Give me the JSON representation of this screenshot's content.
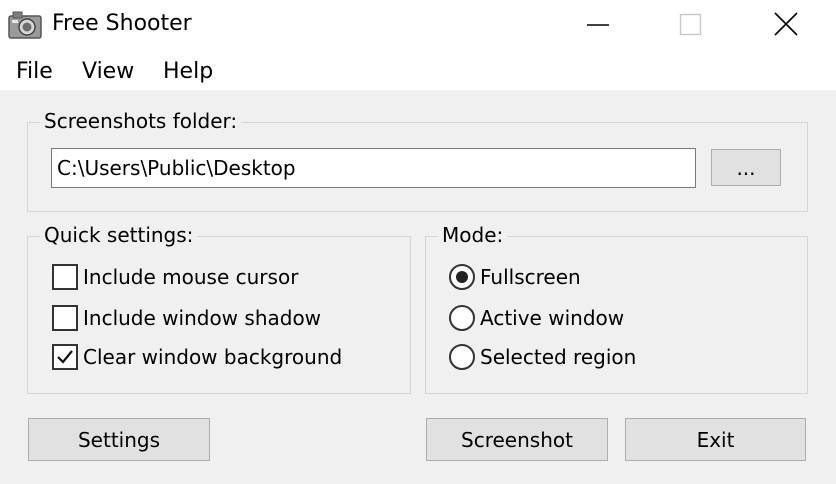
{
  "window": {
    "title": "Free Shooter",
    "app_icon": "camera-icon",
    "controls": [
      "minimize-icon",
      "maximize-icon",
      "close-icon"
    ]
  },
  "menu": [
    "File",
    "View",
    "Help"
  ],
  "folder": {
    "legend": "Screenshots folder:",
    "path": "C:\\Users\\Public\\Desktop",
    "browse_label": "..."
  },
  "quick_settings": {
    "legend": "Quick settings:",
    "options": [
      {
        "label": "Include mouse cursor",
        "checked": false
      },
      {
        "label": "Include window shadow",
        "checked": false
      },
      {
        "label": "Clear window background",
        "checked": true
      }
    ]
  },
  "mode": {
    "legend": "Mode:",
    "options": [
      {
        "label": "Fullscreen",
        "selected": true
      },
      {
        "label": "Active window",
        "selected": false
      },
      {
        "label": "Selected region",
        "selected": false
      }
    ]
  },
  "buttons": {
    "settings": "Settings",
    "screenshot": "Screenshot",
    "exit": "Exit"
  }
}
